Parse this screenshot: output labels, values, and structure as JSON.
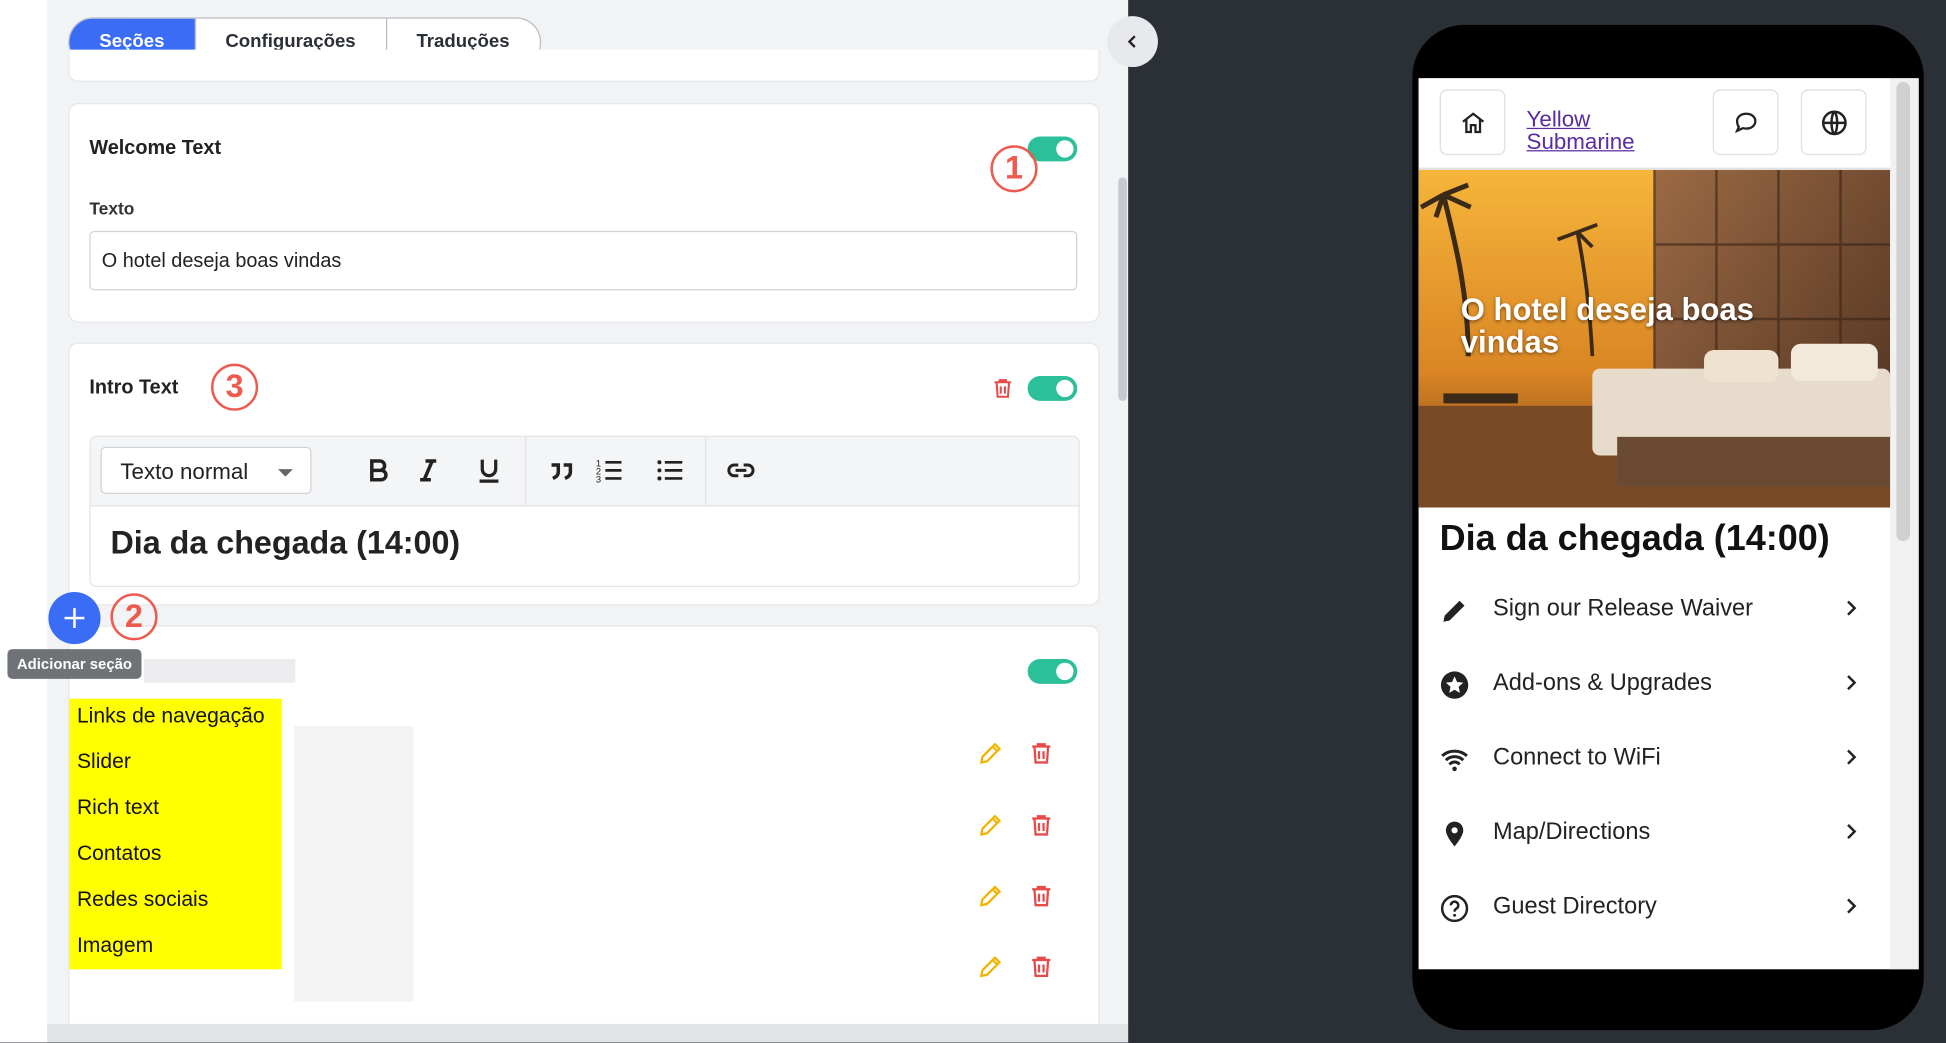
{
  "tabs": [
    {
      "label": "Seções",
      "active": true
    },
    {
      "label": "Configurações",
      "active": false
    },
    {
      "label": "Traduções",
      "active": false
    }
  ],
  "welcome": {
    "title": "Welcome Text",
    "field_label": "Texto",
    "value": "O hotel deseja boas vindas",
    "enabled": true
  },
  "intro": {
    "title": "Intro Text",
    "format_select": "Texto normal",
    "content": "Dia da chegada (14:00)",
    "enabled": true
  },
  "badges": {
    "one": "1",
    "two": "2",
    "three": "3"
  },
  "add_section": {
    "tooltip": "Adicionar seção"
  },
  "section_menu": [
    "Links de navegação",
    "Slider",
    "Rich text",
    "Contatos",
    "Redes sociais",
    "Imagem"
  ],
  "preview": {
    "hotel_name": "Yellow Submarine",
    "hero_text": "O hotel deseja boas vindas",
    "heading": "Dia da chegada (14:00)",
    "items": [
      {
        "label": "Sign our Release Waiver",
        "icon": "pencil-icon"
      },
      {
        "label": "Add-ons & Upgrades",
        "icon": "star-icon"
      },
      {
        "label": "Connect to WiFi",
        "icon": "wifi-icon"
      },
      {
        "label": "Map/Directions",
        "icon": "map-pin-icon"
      },
      {
        "label": "Guest Directory",
        "icon": "help-circle-icon"
      }
    ]
  },
  "colors": {
    "primary": "#3b6cf6",
    "toggle_on": "#2bbf9a",
    "delete": "#e64b4b",
    "edit": "#f2b400",
    "highlight": "#ffff00",
    "annotation": "#ef5a4f"
  }
}
